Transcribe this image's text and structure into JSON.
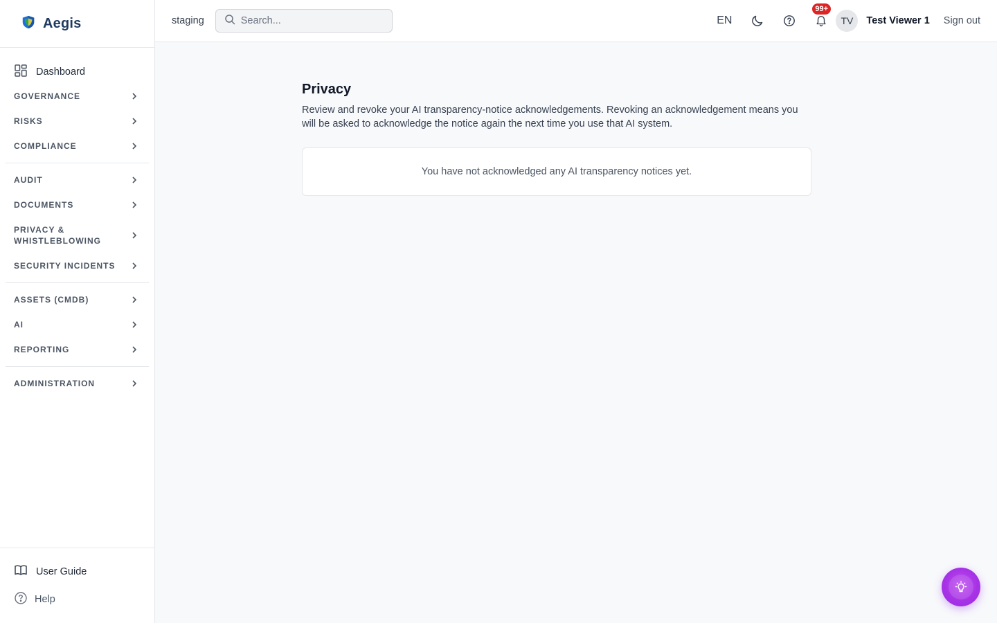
{
  "brand": {
    "name": "Aegis"
  },
  "sidebar": {
    "dashboard": "Dashboard",
    "groups": [
      [
        "GOVERNANCE",
        "RISKS",
        "COMPLIANCE"
      ],
      [
        "AUDIT",
        "DOCUMENTS",
        "PRIVACY & WHISTLEBLOWING",
        "SECURITY INCIDENTS"
      ],
      [
        "ASSETS (CMDB)",
        "AI",
        "REPORTING"
      ],
      [
        "ADMINISTRATION"
      ]
    ],
    "footer": {
      "user_guide": "User Guide",
      "help": "Help"
    }
  },
  "topbar": {
    "environment": "staging",
    "search_placeholder": "Search...",
    "language": "EN",
    "notification_count": "99+",
    "avatar_initials": "TV",
    "user_name": "Test Viewer 1",
    "sign_out": "Sign out"
  },
  "main": {
    "title": "Privacy",
    "description": "Review and revoke your AI transparency-notice acknowledgements. Revoking an acknowledgement means you will be asked to acknowledge the notice again the next time you use that AI system.",
    "empty_message": "You have not acknowledged any AI transparency notices yet."
  },
  "fab": {
    "icon": "lightbulb-icon"
  },
  "colors": {
    "brand_text": "#1e3a5f",
    "badge": "#dc2626",
    "fab": "#a733e6",
    "shield_green": "#2ea44f",
    "shield_blue": "#1e6fd9"
  }
}
